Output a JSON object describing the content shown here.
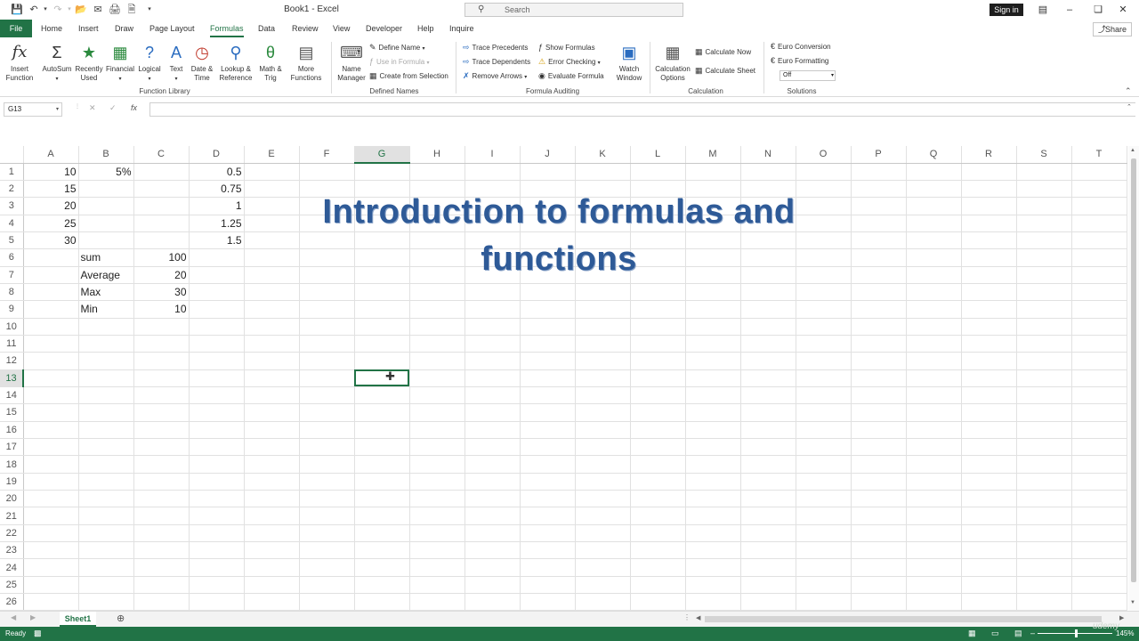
{
  "window": {
    "title": "Book1  -  Excel",
    "search_placeholder": "Search",
    "sign_in": "Sign in"
  },
  "tabs": [
    "File",
    "Home",
    "Insert",
    "Draw",
    "Page Layout",
    "Formulas",
    "Data",
    "Review",
    "View",
    "Developer",
    "Help",
    "Inquire"
  ],
  "active_tab": "Formulas",
  "share_label": "Share",
  "ribbon": {
    "function_library": {
      "label": "Function Library",
      "insert_function": [
        "Insert",
        "Function"
      ],
      "autosum": "AutoSum",
      "recently_used": [
        "Recently",
        "Used"
      ],
      "financial": "Financial",
      "logical": "Logical",
      "text": "Text",
      "date_time": [
        "Date &",
        "Time"
      ],
      "lookup_reference": [
        "Lookup &",
        "Reference"
      ],
      "math_trig": [
        "Math &",
        "Trig"
      ],
      "more_functions": [
        "More",
        "Functions"
      ]
    },
    "defined_names": {
      "label": "Defined Names",
      "name_manager": [
        "Name",
        "Manager"
      ],
      "define_name": "Define Name",
      "use_in_formula": "Use in Formula",
      "create_from_selection": "Create from Selection"
    },
    "formula_auditing": {
      "label": "Formula Auditing",
      "trace_precedents": "Trace Precedents",
      "trace_dependents": "Trace Dependents",
      "remove_arrows": "Remove Arrows",
      "show_formulas": "Show Formulas",
      "error_checking": "Error Checking",
      "evaluate_formula": "Evaluate Formula",
      "watch_window": [
        "Watch",
        "Window"
      ]
    },
    "calculation": {
      "label": "Calculation",
      "calculation_options": [
        "Calculation",
        "Options"
      ],
      "calculate_now": "Calculate Now",
      "calculate_sheet": "Calculate Sheet"
    },
    "solutions": {
      "label": "Solutions",
      "euro_conversion": "Euro Conversion",
      "euro_formatting": "Euro Formatting",
      "euro_select_value": "Off"
    }
  },
  "formula_bar": {
    "name_box": "G13",
    "fx_label": "fx",
    "value": ""
  },
  "columns": [
    "A",
    "B",
    "C",
    "D",
    "E",
    "F",
    "G",
    "H",
    "I",
    "J",
    "K",
    "L",
    "M",
    "N",
    "O",
    "P",
    "Q",
    "R",
    "S",
    "T"
  ],
  "selected_column": "G",
  "selected_row": 13,
  "rows": [
    {
      "n": "1",
      "A": "10",
      "B": "5%",
      "C": "",
      "D": "0.5"
    },
    {
      "n": "2",
      "A": "15",
      "B": "",
      "C": "",
      "D": "0.75"
    },
    {
      "n": "3",
      "A": "20",
      "B": "",
      "C": "",
      "D": "1"
    },
    {
      "n": "4",
      "A": "25",
      "B": "",
      "C": "",
      "D": "1.25"
    },
    {
      "n": "5",
      "A": "30",
      "B": "",
      "C": "",
      "D": "1.5"
    },
    {
      "n": "6",
      "A": "",
      "B": "sum",
      "C": "100",
      "D": ""
    },
    {
      "n": "7",
      "A": "",
      "B": "Average",
      "C": "20",
      "D": ""
    },
    {
      "n": "8",
      "A": "",
      "B": "Max",
      "C": "30",
      "D": ""
    },
    {
      "n": "9",
      "A": "",
      "B": "Min",
      "C": "10",
      "D": ""
    },
    {
      "n": "10"
    },
    {
      "n": "11"
    },
    {
      "n": "12"
    },
    {
      "n": "13"
    },
    {
      "n": "14"
    },
    {
      "n": "15"
    },
    {
      "n": "16"
    },
    {
      "n": "17"
    },
    {
      "n": "18"
    },
    {
      "n": "19"
    },
    {
      "n": "20"
    },
    {
      "n": "21"
    },
    {
      "n": "22"
    },
    {
      "n": "23"
    },
    {
      "n": "24"
    },
    {
      "n": "25"
    },
    {
      "n": "26"
    }
  ],
  "overlay_title": [
    "Introduction to formulas and",
    "functions"
  ],
  "sheets": [
    "Sheet1"
  ],
  "status": {
    "ready": "Ready",
    "zoom": "145%"
  },
  "watermark": "udemy",
  "colors": {
    "excel_green": "#217346",
    "title_blue": "#2e5a97"
  }
}
